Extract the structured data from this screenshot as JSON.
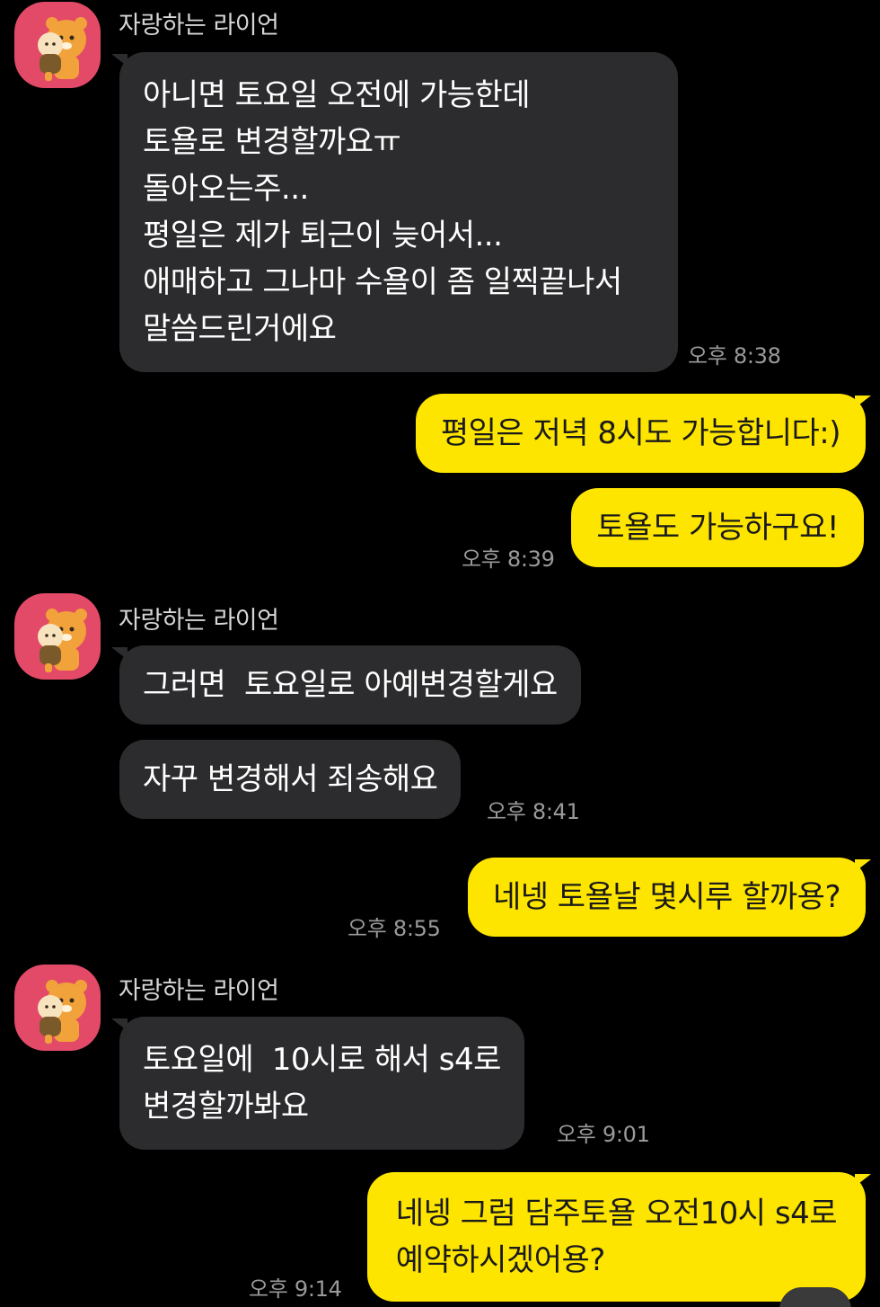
{
  "groups": [
    {
      "sender": "자랑하는 라이언",
      "messages": [
        {
          "text": "아니면 토요일 오전에 가능한데\n토욜로 변경할까요ㅠ\n돌아오는주...\n평일은 제가 퇴근이 늦어서...\n애매하고 그나마 수욜이 좀 일찍끝나서\n말씀드린거에요",
          "time": "오후 8:38"
        }
      ]
    },
    {
      "sender": "me",
      "messages": [
        {
          "text": "평일은 저녁 8시도 가능합니다:)",
          "time": ""
        },
        {
          "text": "토욜도 가능하구요!",
          "time": "오후 8:39"
        }
      ]
    },
    {
      "sender": "자랑하는 라이언",
      "messages": [
        {
          "text": "그러면  토요일로 아예변경할게요",
          "time": ""
        },
        {
          "text": "자꾸 변경해서 죄송해요",
          "time": "오후 8:41"
        }
      ]
    },
    {
      "sender": "me",
      "messages": [
        {
          "text": "네넹 토욜날 몇시루 할까용?",
          "time": "오후 8:55"
        }
      ]
    },
    {
      "sender": "자랑하는 라이언",
      "messages": [
        {
          "text": "토요일에  10시로 해서 s4로\n변경할까봐요",
          "time": "오후 9:01"
        }
      ]
    },
    {
      "sender": "me",
      "messages": [
        {
          "text": "네넹 그럼 담주토욜 오전10시 s4로\n예약하시겠어용?",
          "time": "오후 9:14"
        }
      ]
    }
  ],
  "icons": {
    "avatar": "ryan-character-avatar-icon"
  },
  "colors": {
    "background": "#000000",
    "incoming_bubble": "#2c2c2e",
    "outgoing_bubble": "#fee500",
    "avatar_bg": "#e24a68"
  }
}
